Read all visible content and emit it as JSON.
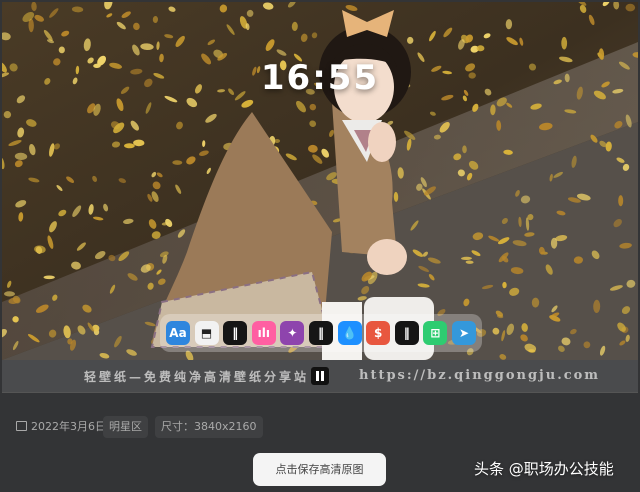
{
  "lockscreen": {
    "time": "16:55"
  },
  "dock_icons": [
    {
      "name": "browser-icon",
      "color": "#2e86de",
      "glyph": "Aa"
    },
    {
      "name": "bag-icon",
      "color": "#f2f2f2",
      "glyph": "⬒"
    },
    {
      "name": "app-logo-icon",
      "color": "#151515",
      "glyph": "‖"
    },
    {
      "name": "chart-app-icon",
      "color": "#ff5fa2",
      "glyph": "ılı"
    },
    {
      "name": "puzzle-icon",
      "color": "#8e44ad",
      "glyph": "✦"
    },
    {
      "name": "app-logo-icon-2",
      "color": "#151515",
      "glyph": "‖"
    },
    {
      "name": "drop-icon",
      "color": "#1e90ff",
      "glyph": "💧"
    },
    {
      "name": "coin-icon",
      "color": "#e8573f",
      "glyph": "$"
    },
    {
      "name": "app-logo-icon-3",
      "color": "#151515",
      "glyph": "‖"
    },
    {
      "name": "grid-app-icon",
      "color": "#2ecc71",
      "glyph": "⊞"
    },
    {
      "name": "send-icon",
      "color": "#3498db",
      "glyph": "➤"
    }
  ],
  "banner": {
    "tagline": "轻壁纸—免费纯净高清壁纸分享站",
    "url": "https://bz.qinggongju.com"
  },
  "meta": {
    "date": "2022年3月6日",
    "category": "明星区",
    "size": "尺寸：3840x2160"
  },
  "actions": {
    "save_label": "点击保存高清原图"
  },
  "watermark": "头条 @职场办公技能"
}
